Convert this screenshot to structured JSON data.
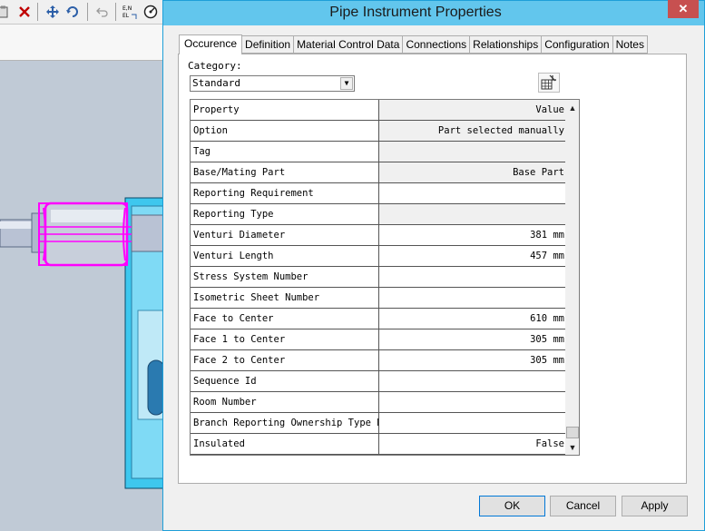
{
  "app_toolbar": {
    "icons": [
      "clipboard-icon",
      "delete-icon",
      "move-icon",
      "rotate-icon",
      "undo-icon",
      "coordinates-icon",
      "measure-icon"
    ],
    "coord_label": "E,N\nEL"
  },
  "dialog": {
    "title": "Pipe Instrument Properties",
    "close_glyph": "✕",
    "tabs": [
      {
        "label": "Occurence",
        "active": true
      },
      {
        "label": "Definition",
        "active": false
      },
      {
        "label": "Material Control Data",
        "active": false
      },
      {
        "label": "Connections",
        "active": false
      },
      {
        "label": "Relationships",
        "active": false
      },
      {
        "label": "Configuration",
        "active": false
      },
      {
        "label": "Notes",
        "active": false
      }
    ],
    "category_label": "Category:",
    "category_value": "Standard",
    "grid": {
      "header": {
        "property": "Property",
        "value": "Value"
      },
      "rows": [
        {
          "property": "Option",
          "value": "Part selected manually",
          "readonly": true
        },
        {
          "property": "Tag",
          "value": "",
          "readonly": true
        },
        {
          "property": "Base/Mating Part",
          "value": "Base Part",
          "readonly": true
        },
        {
          "property": "Reporting Requirement",
          "value": "",
          "readonly": false
        },
        {
          "property": "Reporting Type",
          "value": "",
          "readonly": true
        },
        {
          "property": "Venturi Diameter",
          "value": "381 mm",
          "readonly": false
        },
        {
          "property": "Venturi Length",
          "value": "457 mm",
          "readonly": false
        },
        {
          "property": "Stress System Number",
          "value": "",
          "readonly": false
        },
        {
          "property": "Isometric Sheet Number",
          "value": "",
          "readonly": false
        },
        {
          "property": "Face to Center",
          "value": "610 mm",
          "readonly": false
        },
        {
          "property": "Face 1 to Center",
          "value": "305 mm",
          "readonly": false
        },
        {
          "property": "Face 2 to Center",
          "value": "305 mm",
          "readonly": false
        },
        {
          "property": "Sequence Id",
          "value": "",
          "readonly": false
        },
        {
          "property": "Room Number",
          "value": "",
          "readonly": false
        },
        {
          "property": "Branch Reporting Ownership Type Bs",
          "value": "",
          "readonly": false
        },
        {
          "property": "Insulated",
          "value": "False",
          "readonly": false
        }
      ]
    },
    "buttons": {
      "ok": "OK",
      "cancel": "Cancel",
      "apply": "Apply"
    }
  }
}
